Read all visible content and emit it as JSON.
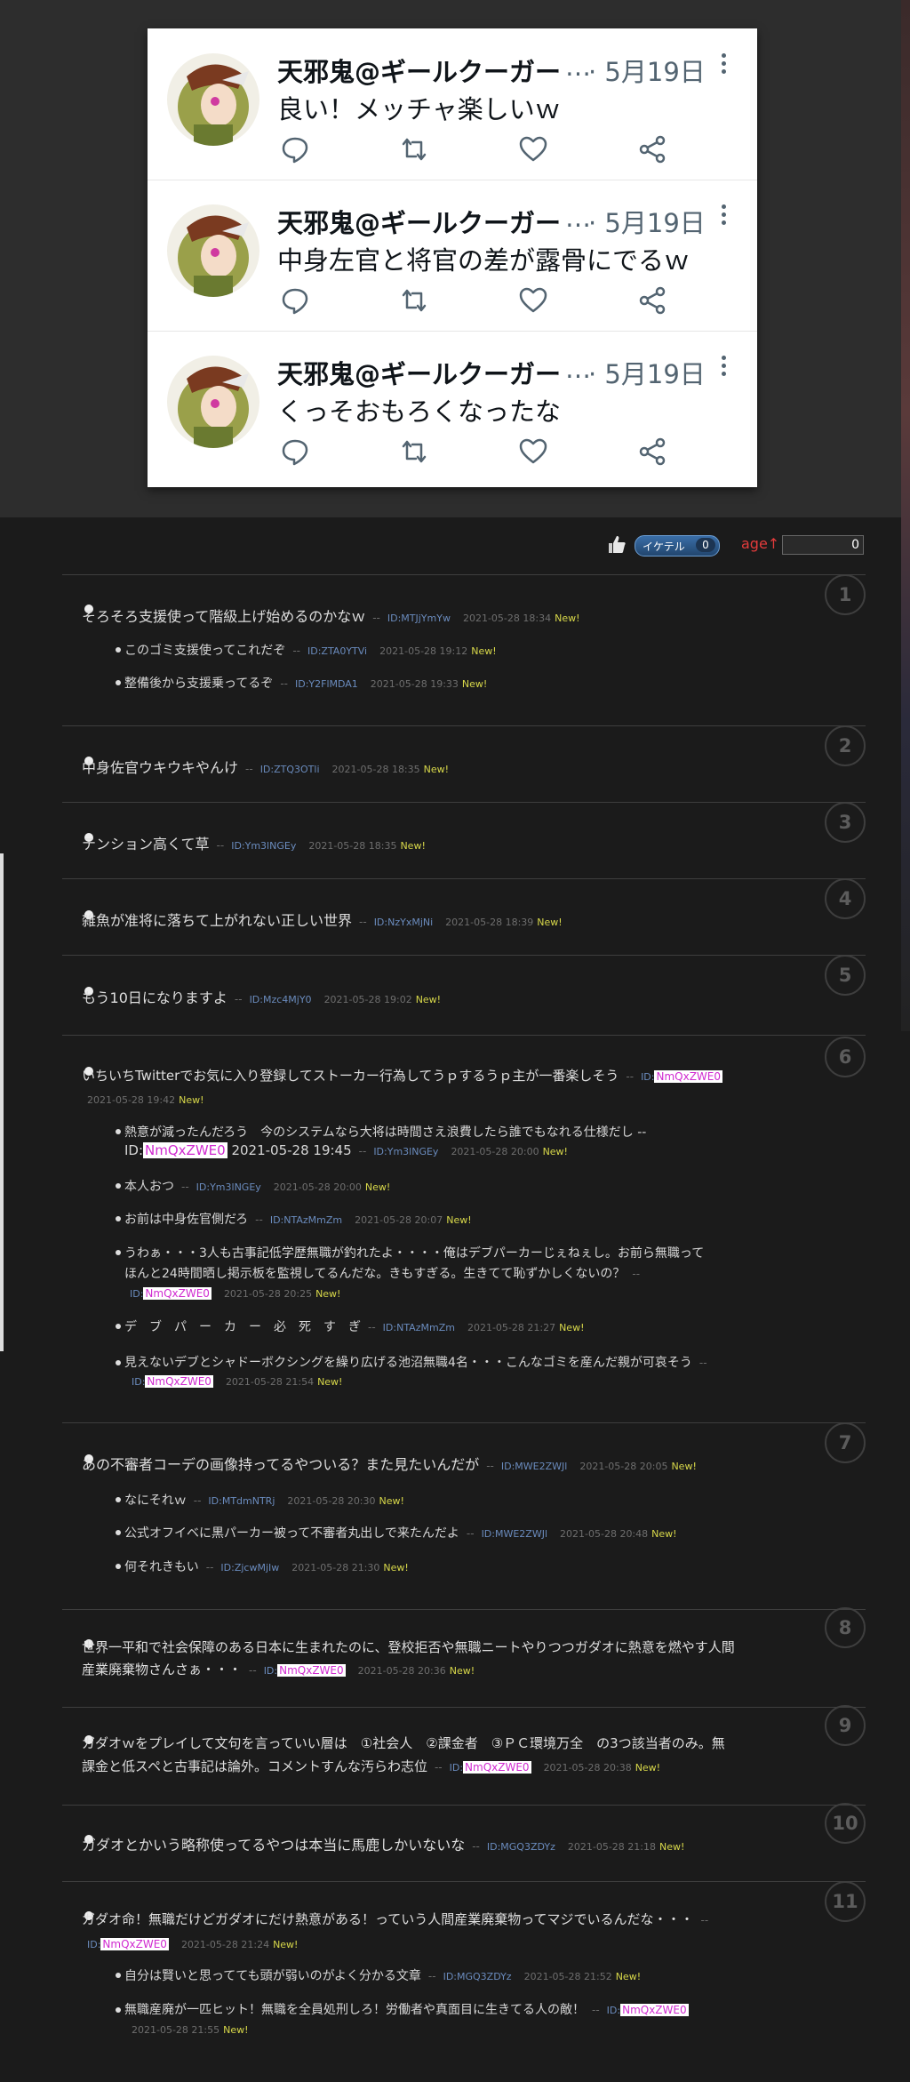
{
  "tweets": [
    {
      "author": "天邪鬼@ギールクーガー",
      "ellipsis": "…",
      "date": "· 5月19日",
      "text": "良い！メッチャ楽しいｗ"
    },
    {
      "author": "天邪鬼@ギールクーガー",
      "ellipsis": "…",
      "date": "· 5月19日",
      "text": "中身左官と将官の差が露骨にでるｗ"
    },
    {
      "author": "天邪鬼@ギールクーガー",
      "ellipsis": "…",
      "date": "· 5月19日",
      "text": "くっそおもろくなったな"
    }
  ],
  "rating": {
    "ikeru_label": "イケテル",
    "ikeru_count": "0",
    "age_label": "age↑",
    "age_count": "0"
  },
  "comments": [
    {
      "num": "1",
      "text": "そろそろ支援使って階級上げ始めるのかなｗ",
      "dash": "--",
      "id": "ID:MTJjYmYw",
      "date": "2021-05-28 18:34",
      "new": "New!",
      "replies": [
        {
          "text": "このゴミ支援使ってこれだぞ",
          "dash": "--",
          "id": "ID:ZTA0YTVi",
          "date": "2021-05-28 19:12",
          "new": "New!"
        },
        {
          "text": "整備後から支援乗ってるぞ",
          "dash": "--",
          "id": "ID:Y2FlMDA1",
          "date": "2021-05-28 19:33",
          "new": "New!"
        }
      ]
    },
    {
      "num": "2",
      "text": "中身佐官ウキウキやんけ",
      "dash": "--",
      "id": "ID:ZTQ3OTli",
      "date": "2021-05-28 18:35",
      "new": "New!"
    },
    {
      "num": "3",
      "text": "テンション高くて草",
      "dash": "--",
      "id": "ID:Ym3lNGEy",
      "date": "2021-05-28 18:35",
      "new": "New!"
    },
    {
      "num": "4",
      "text": "雑魚が准将に落ちて上がれない正しい世界",
      "dash": "--",
      "id": "ID:NzYxMjNi",
      "date": "2021-05-28 18:39",
      "new": "New!"
    },
    {
      "num": "5",
      "text": "もう10日になりますよ",
      "dash": "--",
      "id": "ID:Mzc4MjY0",
      "date": "2021-05-28 19:02",
      "new": "New!"
    },
    {
      "num": "6",
      "text": "いちいちTwitterでお気に入り登録してストーカー行為してうｐするうｐ主が一番楽しそう",
      "dash": "--",
      "id_prefix": "ID:",
      "id_hl": "NmQxZWE0",
      "date": "2021-05-28 19:42",
      "new": "New!",
      "replies": [
        {
          "line1": "熱意が減ったんだろう　今のシステムなら大将は時間さえ浪費したら誰でもなれる仕様だし --",
          "line2_prefix": "ID:",
          "line2_hl": "NmQxZWE0",
          "line2_date": "2021-05-28 19:45",
          "dash": "--",
          "id": "ID:Ym3lNGEy",
          "date": "2021-05-28 20:00",
          "new": "New!"
        },
        {
          "text": "本人おつ",
          "dash": "--",
          "id": "ID:Ym3lNGEy",
          "date": "2021-05-28 20:00",
          "new": "New!"
        },
        {
          "text": "お前は中身佐官側だろ",
          "dash": "--",
          "id": "ID:NTAzMmZm",
          "date": "2021-05-28 20:07",
          "new": "New!"
        },
        {
          "line1": "うわぁ・・・3人も古事記低学歴無職が釣れたよ・・・・俺はデブパーカーじぇねぇし。お前ら無職って",
          "line2": "ほんと24時間晒し掲示板を監視してるんだな。きもすぎる。生きてて恥ずかしくないの？",
          "dash": "--",
          "id_prefix": "ID:",
          "id_hl": "NmQxZWE0",
          "date": "2021-05-28 20:25",
          "new": "New!"
        },
        {
          "text": "デ　ブ　パ　ー　カ　ー　必　死　す　ぎ",
          "dash": "--",
          "id": "ID:NTAzMmZm",
          "date": "2021-05-28 21:27",
          "new": "New!"
        },
        {
          "text": "見えないデブとシャドーボクシングを繰り広げる池沼無職4名・・・こんなゴミを産んだ親が可哀そう",
          "dash": "--",
          "id_prefix": "ID:",
          "id_hl": "NmQxZWE0",
          "date": "2021-05-28 21:54",
          "new": "New!"
        }
      ]
    },
    {
      "num": "7",
      "text": "あの不審者コーデの画像持ってるやついる？また見たいんだが",
      "dash": "--",
      "id": "ID:MWE2ZWJl",
      "date": "2021-05-28 20:05",
      "new": "New!",
      "replies": [
        {
          "text": "なにそれｗ",
          "dash": "--",
          "id": "ID:MTdmNTRj",
          "date": "2021-05-28 20:30",
          "new": "New!"
        },
        {
          "text": "公式オフイベに黒パーカー被って不審者丸出しで来たんだよ",
          "dash": "--",
          "id": "ID:MWE2ZWJl",
          "date": "2021-05-28 20:48",
          "new": "New!"
        },
        {
          "text": "何それきもい",
          "dash": "--",
          "id": "ID:ZjcwMjIw",
          "date": "2021-05-28 21:30",
          "new": "New!"
        }
      ]
    },
    {
      "num": "8",
      "line1": "世界一平和で社会保障のある日本に生まれたのに、登校拒否や無職ニートやりつつガダオに熱意を燃やす人間",
      "line2": "産業廃棄物さんさぁ・・・",
      "dash": "--",
      "id_prefix": "ID:",
      "id_hl": "NmQxZWE0",
      "date": "2021-05-28 20:36",
      "new": "New!"
    },
    {
      "num": "9",
      "line1": "ガダオｗをプレイして文句を言っていい層は　①社会人　②課金者　③ＰＣ環境万全　の3つ該当者のみ。無",
      "line2": "課金と低スペと古事記は論外。コメントすんな汚らわ志位",
      "dash": "--",
      "id_prefix": "ID:",
      "id_hl": "NmQxZWE0",
      "date": "2021-05-28 20:38",
      "new": "New!"
    },
    {
      "num": "10",
      "text": "ガダオとかいう略称使ってるやつは本当に馬鹿しかいないな",
      "dash": "--",
      "id": "ID:MGQ3ZDYz",
      "date": "2021-05-28 21:18",
      "new": "New!"
    },
    {
      "num": "11",
      "text": "ガダオ命！無職だけどガダオにだけ熱意がある！っていう人間産業廃棄物ってマジでいるんだな・・・",
      "dash": "--",
      "id_prefix": "ID:",
      "id_hl": "NmQxZWE0",
      "date": "2021-05-28 21:24",
      "new": "New!",
      "replies": [
        {
          "text": "自分は賢いと思ってても頭が弱いのがよく分かる文章",
          "dash": "--",
          "id": "ID:MGQ3ZDYz",
          "date": "2021-05-28 21:52",
          "new": "New!"
        },
        {
          "text": "無職産廃が一匹ヒット！無職を全員処刑しろ！労働者や真面目に生きてる人の敵！",
          "dash": "--",
          "id_prefix": "ID:",
          "id_hl": "NmQxZWE0",
          "date": "2021-05-28 21:55",
          "new": "New!"
        }
      ]
    }
  ]
}
